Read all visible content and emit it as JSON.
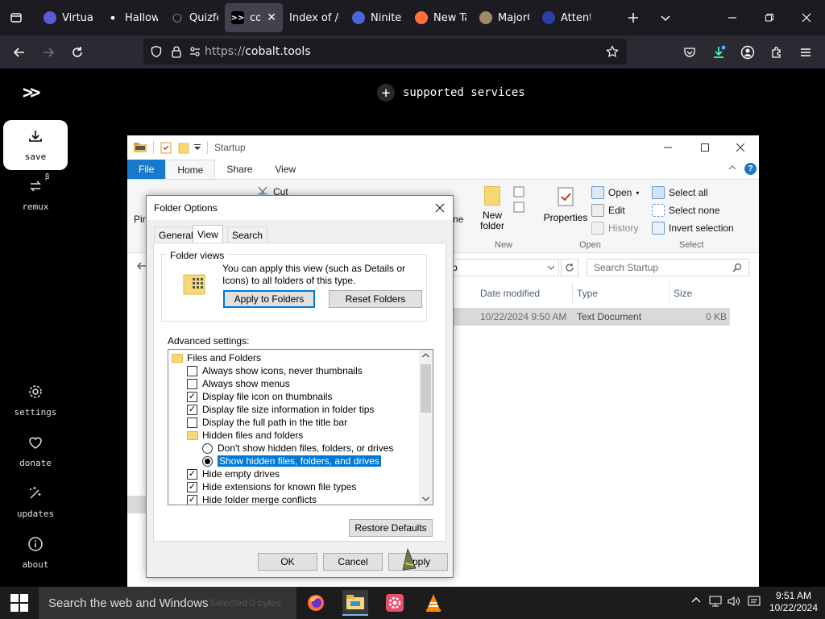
{
  "browser": {
    "tabs": [
      {
        "title": "Virtual",
        "favicon": "menu-lines-icon",
        "color": "#5b5bd6"
      },
      {
        "title": "Hallow",
        "favicon": "dot-icon",
        "color": "#fbfbfe"
      },
      {
        "title": "Quizfo",
        "favicon": "search-icon",
        "color": "#9a9aa5"
      },
      {
        "title": "cob",
        "favicon": "cobalt-icon",
        "color": "#000000",
        "active": true
      },
      {
        "title": "Index of /g",
        "favicon": "",
        "color": ""
      },
      {
        "title": "Ninite",
        "favicon": "ninite-icon",
        "color": "#4a67d6"
      },
      {
        "title": "New Ta",
        "favicon": "firefox-icon",
        "color": "#ff7139"
      },
      {
        "title": "MajorG",
        "favicon": "majorg-icon",
        "color": "#9c8a6a"
      },
      {
        "title": "Attent",
        "favicon": "attention-icon",
        "color": "#2a3fa8"
      }
    ],
    "url_scheme": "https://",
    "url_host": "cobalt.tools"
  },
  "cobalt": {
    "logo": ">>",
    "supported_services": "supported services",
    "sidebar": [
      {
        "label": "save",
        "icon": "download-icon"
      },
      {
        "label": "remux",
        "icon": "remux-icon",
        "badge": "β"
      },
      {
        "label": "settings",
        "icon": "gear-icon"
      },
      {
        "label": "donate",
        "icon": "heart-icon"
      },
      {
        "label": "updates",
        "icon": "sparkle-icon"
      },
      {
        "label": "about",
        "icon": "info-icon"
      }
    ]
  },
  "explorer": {
    "title": "Startup",
    "ribbon_tabs": [
      "File",
      "Home",
      "Share",
      "View"
    ],
    "ribbon": {
      "cut": "Cut",
      "pin": "Pin",
      "new_folder_line1": "New",
      "new_folder_line2": "folder",
      "new_group": "New",
      "properties": "Properties",
      "open": "Open",
      "edit": "Edit",
      "history": "History",
      "open_group": "Open",
      "select_all": "Select all",
      "select_none": "Select none",
      "invert_selection": "Invert selection",
      "select_group": "Select",
      "partial_ne": "ne"
    },
    "address_fragment": "p",
    "search_placeholder": "Search Startup",
    "columns": [
      "Date modified",
      "Type",
      "Size"
    ],
    "file": {
      "date": "10/22/2024 9:50 AM",
      "type": "Text Document",
      "size": "0 KB"
    },
    "status": "Selected  0 bytes"
  },
  "folder_options": {
    "title": "Folder Options",
    "tabs": [
      "General",
      "View",
      "Search"
    ],
    "active_tab": "View",
    "folder_views_legend": "Folder views",
    "folder_views_desc": "You can apply this view (such as Details or Icons) to all folders of this type.",
    "apply_to_folders": "Apply to Folders",
    "reset_folders": "Reset Folders",
    "advanced_label": "Advanced settings:",
    "advanced_items": [
      {
        "type": "folder",
        "label": "Files and Folders",
        "indent": 0
      },
      {
        "type": "checkbox",
        "label": "Always show icons, never thumbnails",
        "checked": false,
        "indent": 1
      },
      {
        "type": "checkbox",
        "label": "Always show menus",
        "checked": false,
        "indent": 1
      },
      {
        "type": "checkbox",
        "label": "Display file icon on thumbnails",
        "checked": true,
        "indent": 1
      },
      {
        "type": "checkbox",
        "label": "Display file size information in folder tips",
        "checked": true,
        "indent": 1
      },
      {
        "type": "checkbox",
        "label": "Display the full path in the title bar",
        "checked": false,
        "indent": 1
      },
      {
        "type": "folder",
        "label": "Hidden files and folders",
        "indent": 1
      },
      {
        "type": "radio",
        "label": "Don't show hidden files, folders, or drives",
        "checked": false,
        "indent": 2
      },
      {
        "type": "radio",
        "label": "Show hidden files, folders, and drives",
        "checked": true,
        "selected": true,
        "indent": 2
      },
      {
        "type": "checkbox",
        "label": "Hide empty drives",
        "checked": true,
        "indent": 1
      },
      {
        "type": "checkbox",
        "label": "Hide extensions for known file types",
        "checked": true,
        "indent": 1
      },
      {
        "type": "checkbox",
        "label": "Hide folder merge conflicts",
        "checked": true,
        "indent": 1
      }
    ],
    "restore_defaults": "Restore Defaults",
    "ok": "OK",
    "cancel": "Cancel",
    "apply": "Apply"
  },
  "taskbar": {
    "search_placeholder": "Search the web and Windows",
    "time": "9:51 AM",
    "date": "10/22/2024",
    "apps": [
      "firefox-icon",
      "file-explorer-icon",
      "settings-app-icon",
      "vlc-icon"
    ]
  },
  "colors": {
    "accent_blue": "#0078d7",
    "file_tab_blue": "#1979ca",
    "browser_tabbar": "#1c1b22",
    "browser_navbar": "#2b2a33",
    "taskbar": "#1c1c1c"
  }
}
